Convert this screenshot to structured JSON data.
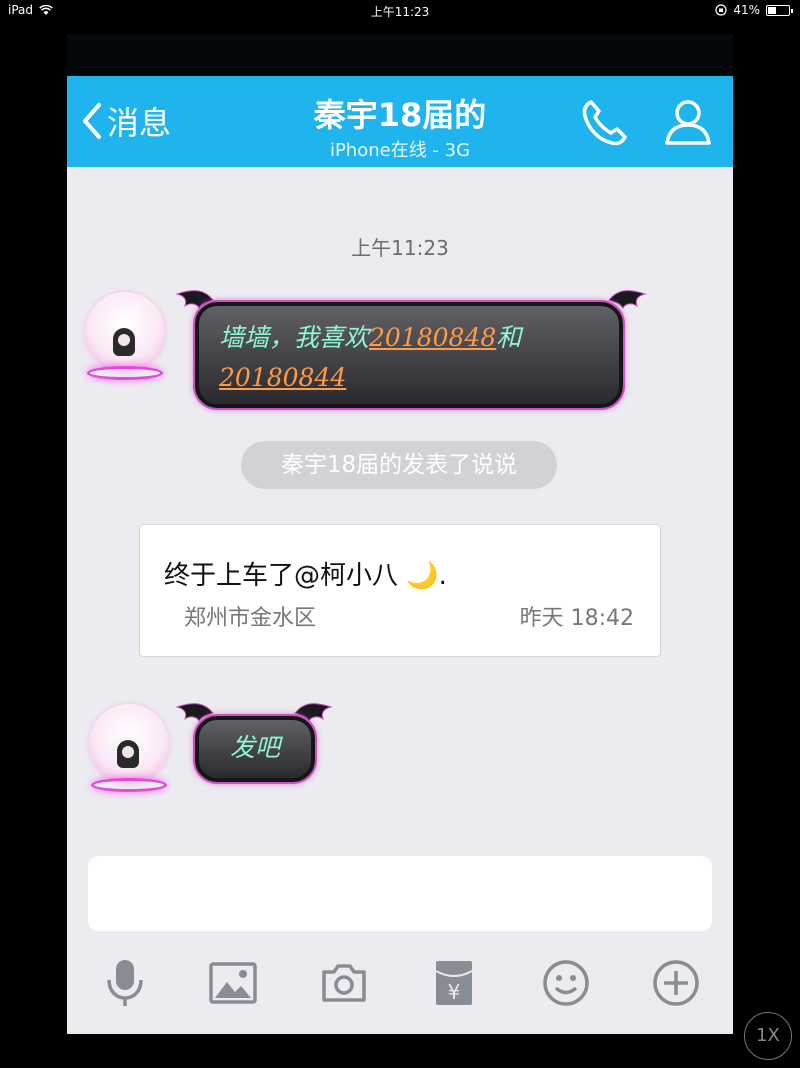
{
  "status_bar": {
    "device": "iPad",
    "time": "上午11:23",
    "battery": "41%",
    "battery_level": 0.41
  },
  "header": {
    "back_label": "消息",
    "title": "秦宇18届的",
    "subtitle": "iPhone在线 - 3G"
  },
  "chat": {
    "timestamp": "上午11:23",
    "messages": [
      {
        "text_before": "墙墙，我喜欢",
        "num1": "20180848",
        "text_mid": "和",
        "num2": "20180844"
      },
      {
        "text": "发吧"
      }
    ],
    "system_notice": "秦宇18届的发表了说说",
    "moment": {
      "content": "终于上车了@柯小八",
      "emoji": "🌙",
      "trailing": ".",
      "location": "郑州市金水区",
      "time": "昨天 18:42"
    }
  },
  "input": {
    "placeholder": ""
  },
  "toolbar_icons": [
    "microphone-icon",
    "image-icon",
    "camera-icon",
    "red-packet-icon",
    "emoji-icon",
    "plus-icon"
  ],
  "zoom_label": "1X",
  "colors": {
    "nav": "#1fb4ee",
    "bubble_text": "#8ff5d5",
    "bubble_number": "#ff9a48",
    "glow": "#d04fc3"
  }
}
